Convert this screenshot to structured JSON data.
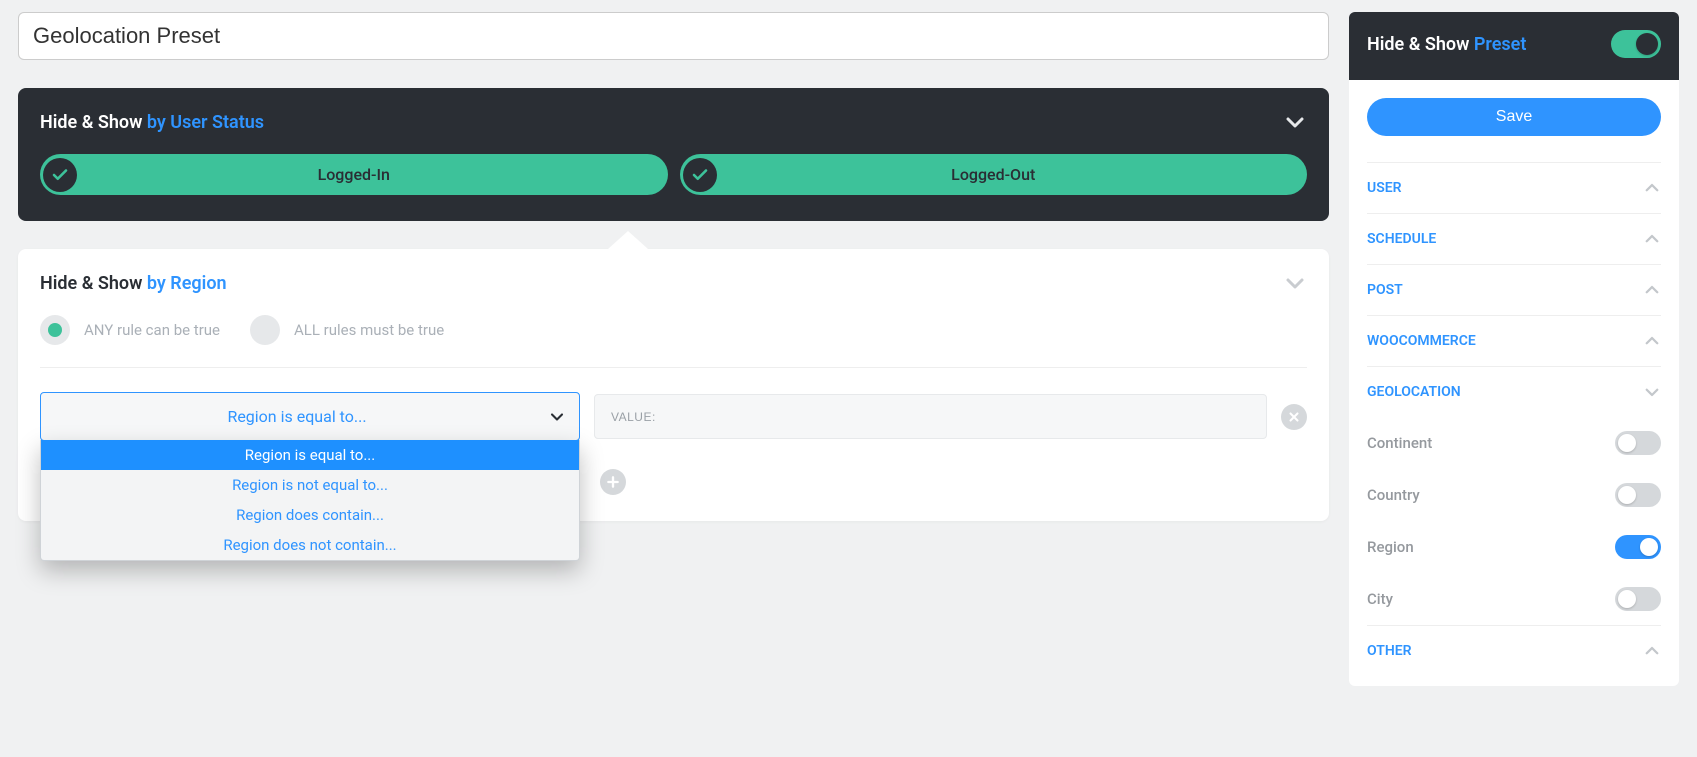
{
  "title": "Geolocation Preset",
  "panel_user_status": {
    "prefix": "Hide & Show ",
    "suffix": "by User Status",
    "pills": [
      "Logged-In",
      "Logged-Out"
    ]
  },
  "panel_region": {
    "prefix": "Hide & Show ",
    "suffix": "by Region",
    "rule_mode": {
      "any": "ANY rule can be true",
      "all": "ALL rules must be true"
    },
    "select_value": "Region is equal to...",
    "dropdown": [
      "Region is equal to...",
      "Region is not equal to...",
      "Region does contain...",
      "Region does not contain..."
    ],
    "value_placeholder": "VALUE:"
  },
  "sidebar": {
    "header_prefix": "Hide & Show ",
    "header_suffix": "Preset",
    "save": "Save",
    "sections": {
      "user": "USER",
      "schedule": "SCHEDULE",
      "post": "POST",
      "woocommerce": "WOOCOMMERCE",
      "geolocation": "GEOLOCATION",
      "other": "OTHER"
    },
    "geo_items": {
      "continent": "Continent",
      "country": "Country",
      "region": "Region",
      "city": "City"
    }
  }
}
